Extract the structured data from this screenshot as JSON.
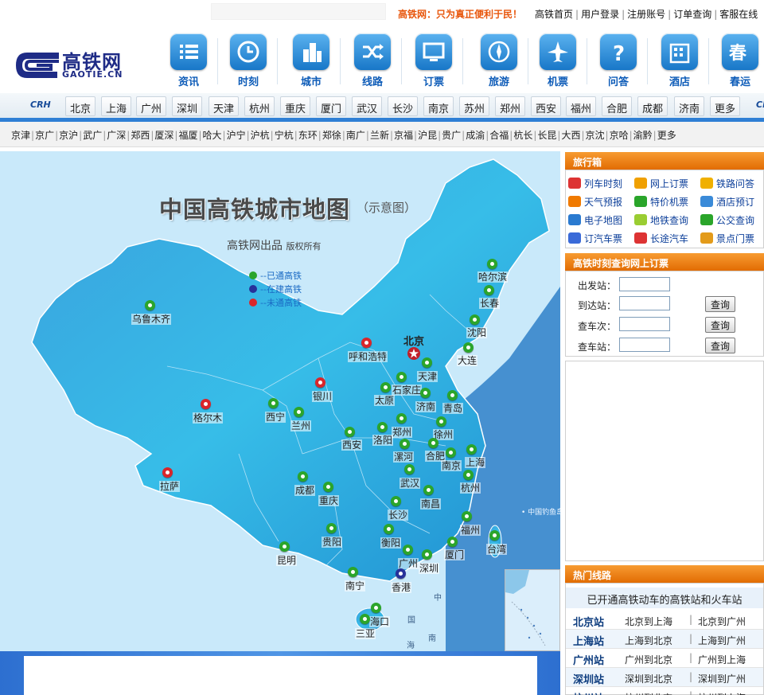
{
  "top": {
    "slogan": "高铁网：只为真正便利于民！",
    "links": [
      "高铁首页",
      "用户登录",
      "注册账号",
      "订单查询",
      "客服在线"
    ]
  },
  "logo": {
    "cn": "高铁网",
    "en": "GAOTIE.CN"
  },
  "nav": [
    {
      "label": "资讯",
      "icon": "list-icon"
    },
    {
      "label": "时刻",
      "icon": "clock-icon"
    },
    {
      "label": "城市",
      "icon": "buildings-icon"
    },
    {
      "label": "线路",
      "icon": "shuffle-icon"
    },
    {
      "label": "订票",
      "icon": "monitor-icon"
    },
    {
      "label": "旅游",
      "icon": "compass-icon"
    },
    {
      "label": "机票",
      "icon": "airplane-icon"
    },
    {
      "label": "问答",
      "icon": "question-icon"
    },
    {
      "label": "酒店",
      "icon": "hotel-icon"
    },
    {
      "label": "春运",
      "icon": "chun-icon"
    }
  ],
  "city_bar": {
    "crh_label": "CRH",
    "cities": [
      "北京",
      "上海",
      "广州",
      "深圳",
      "天津",
      "杭州",
      "重庆",
      "厦门",
      "武汉",
      "长沙",
      "南京",
      "苏州",
      "郑州",
      "西安",
      "福州",
      "合肥",
      "成都",
      "济南",
      "更多"
    ]
  },
  "lines": [
    "京津",
    "京广",
    "京沪",
    "武广",
    "广深",
    "郑西",
    "厦深",
    "福厦",
    "哈大",
    "沪宁",
    "沪杭",
    "宁杭",
    "东环",
    "郑徐",
    "南广",
    "兰新",
    "京福",
    "沪昆",
    "贵广",
    "成渝",
    "合福",
    "杭长",
    "长昆",
    "大西",
    "京沈",
    "京哈",
    "渝黔",
    "更多"
  ],
  "map": {
    "title": "中国高铁城市地图",
    "title_note": "（示意图）",
    "credit": "高铁网出品",
    "credit_small": "版权所有",
    "legend": [
      {
        "text": "--已通高铁",
        "color": "#2ba52b"
      },
      {
        "text": "--在建高铁",
        "color": "#27319a"
      },
      {
        "text": "--未通高铁",
        "color": "#d9262b"
      }
    ],
    "diaoyu": "• 中国钓鱼岛",
    "sea1": "中",
    "sea2": "国",
    "sea3": "海",
    "sea4": "南",
    "cities": [
      {
        "name": "哈尔滨",
        "status": "g"
      },
      {
        "name": "长春",
        "status": "g"
      },
      {
        "name": "乌鲁木齐",
        "status": "g"
      },
      {
        "name": "沈阳",
        "status": "g"
      },
      {
        "name": "北京",
        "status": "capital"
      },
      {
        "name": "大连",
        "status": "g"
      },
      {
        "name": "呼和浩特",
        "status": "r"
      },
      {
        "name": "天津",
        "status": "g"
      },
      {
        "name": "石家庄",
        "status": "g"
      },
      {
        "name": "银川",
        "status": "r"
      },
      {
        "name": "太原",
        "status": "g"
      },
      {
        "name": "济南",
        "status": "g"
      },
      {
        "name": "青岛",
        "status": "g"
      },
      {
        "name": "格尔木",
        "status": "r"
      },
      {
        "name": "西宁",
        "status": "g"
      },
      {
        "name": "兰州",
        "status": "g"
      },
      {
        "name": "郑州",
        "status": "g"
      },
      {
        "name": "徐州",
        "status": "g"
      },
      {
        "name": "西安",
        "status": "g"
      },
      {
        "name": "洛阳",
        "status": "g"
      },
      {
        "name": "合肥",
        "status": "g"
      },
      {
        "name": "漯河",
        "status": "g"
      },
      {
        "name": "南京",
        "status": "g"
      },
      {
        "name": "上海",
        "status": "g"
      },
      {
        "name": "拉萨",
        "status": "r"
      },
      {
        "name": "成都",
        "status": "g"
      },
      {
        "name": "武汉",
        "status": "g"
      },
      {
        "name": "杭州",
        "status": "g"
      },
      {
        "name": "重庆",
        "status": "g"
      },
      {
        "name": "南昌",
        "status": "g"
      },
      {
        "name": "长沙",
        "status": "g"
      },
      {
        "name": "贵阳",
        "status": "g"
      },
      {
        "name": "衡阳",
        "status": "g"
      },
      {
        "name": "福州",
        "status": "g"
      },
      {
        "name": "台湾",
        "status": "g"
      },
      {
        "name": "昆明",
        "status": "g"
      },
      {
        "name": "厦门",
        "status": "g"
      },
      {
        "name": "广州",
        "status": "g"
      },
      {
        "name": "深圳",
        "status": "g"
      },
      {
        "name": "南宁",
        "status": "g"
      },
      {
        "name": "香港",
        "status": "b"
      },
      {
        "name": "海口",
        "status": "g"
      },
      {
        "name": "三亚",
        "status": "g"
      }
    ]
  },
  "sidebar": {
    "toolbox_title": "旅行箱",
    "tools": [
      {
        "label": "列车时刻",
        "icon": "train-icon",
        "color": "#d33"
      },
      {
        "label": "网上订票",
        "icon": "ticket-icon",
        "color": "#f0a000"
      },
      {
        "label": "铁路问答",
        "icon": "question-icon",
        "color": "#f0b000"
      },
      {
        "label": "天气预报",
        "icon": "sun-icon",
        "color": "#f07a00"
      },
      {
        "label": "特价机票",
        "icon": "plane-icon",
        "color": "#2aa52a"
      },
      {
        "label": "酒店预订",
        "icon": "hotel-icon",
        "color": "#3a8ad8"
      },
      {
        "label": "电子地图",
        "icon": "globe-icon",
        "color": "#2a7ad0"
      },
      {
        "label": "地铁查询",
        "icon": "subway-icon",
        "color": "#9acd32"
      },
      {
        "label": "公交查询",
        "icon": "bus-icon",
        "color": "#2aa52a"
      },
      {
        "label": "订汽车票",
        "icon": "coach-icon",
        "color": "#3a6ad8"
      },
      {
        "label": "长途汽车",
        "icon": "car-icon",
        "color": "#d33"
      },
      {
        "label": "景点门票",
        "icon": "scenic-icon",
        "color": "#e39b1a"
      }
    ],
    "booking_title": "高铁时刻查询网上订票",
    "form": {
      "from_label": "出发站：",
      "to_label": "到达站：",
      "train_label": "查车次：",
      "station_label": "查车站：",
      "query_btn": "查询"
    },
    "hot_title": "热门线路",
    "hot_caption": "已开通高铁动车的高铁站和火车站",
    "hot_rows": [
      {
        "station": "北京站",
        "l1": "北京到上海",
        "l2": "北京到广州"
      },
      {
        "station": "上海站",
        "l1": "上海到北京",
        "l2": "上海到广州"
      },
      {
        "station": "广州站",
        "l1": "广州到北京",
        "l2": "广州到上海"
      },
      {
        "station": "深圳站",
        "l1": "深圳到北京",
        "l2": "深圳到广州"
      },
      {
        "station": "杭州站",
        "l1": "杭州到北京",
        "l2": "杭州到上海"
      }
    ]
  }
}
